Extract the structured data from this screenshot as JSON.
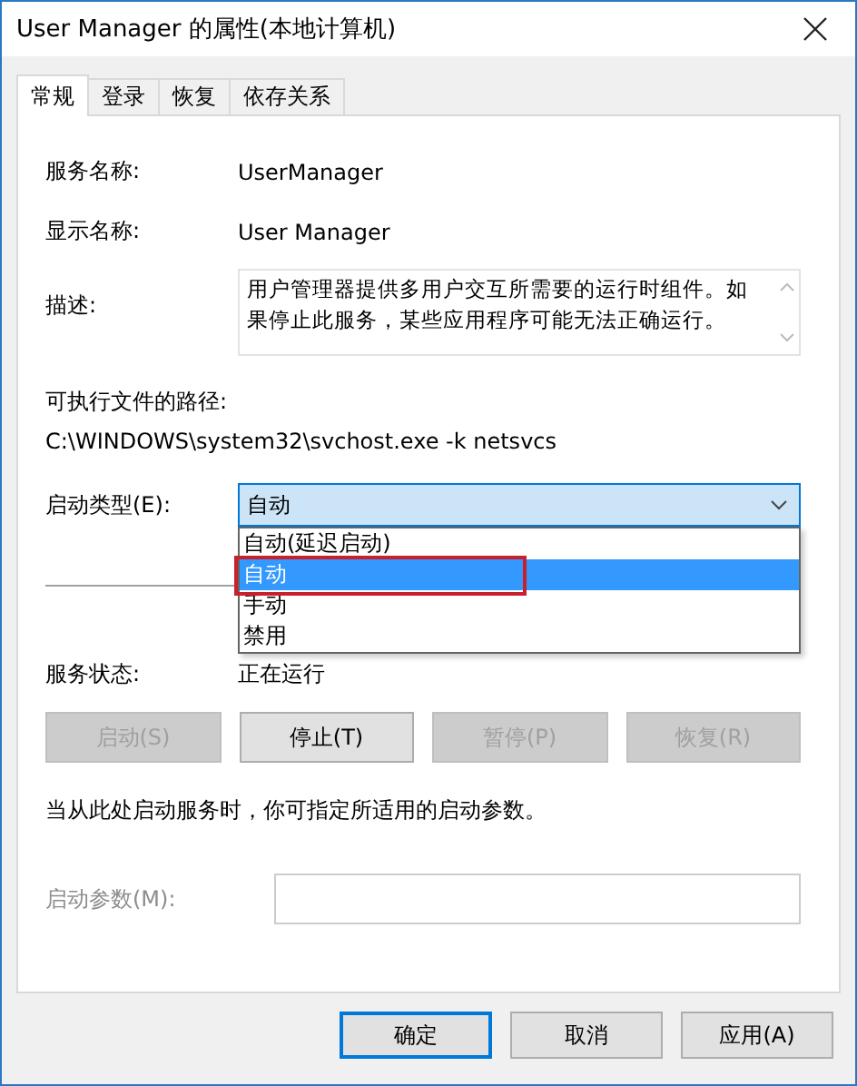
{
  "window": {
    "title": "User Manager 的属性(本地计算机)"
  },
  "tabs": [
    {
      "label": "常规",
      "selected": true
    },
    {
      "label": "登录",
      "selected": false
    },
    {
      "label": "恢复",
      "selected": false
    },
    {
      "label": "依存关系",
      "selected": false
    }
  ],
  "service_name": {
    "label": "服务名称:",
    "value": "UserManager"
  },
  "display_name": {
    "label": "显示名称:",
    "value": "User Manager"
  },
  "description": {
    "label": "描述:",
    "value": "用户管理器提供多用户交互所需要的运行时组件。如果停止此服务，某些应用程序可能无法正确运行。"
  },
  "executable": {
    "label": "可执行文件的路径:",
    "value": "C:\\WINDOWS\\system32\\svchost.exe -k netsvcs"
  },
  "startup_type": {
    "label": "启动类型(E):",
    "value": "自动",
    "expanded": true,
    "options": [
      {
        "label": "自动(延迟启动)",
        "selected": false
      },
      {
        "label": "自动",
        "selected": true
      },
      {
        "label": "手动",
        "selected": false
      },
      {
        "label": "禁用",
        "selected": false
      }
    ]
  },
  "service_status": {
    "label": "服务状态:",
    "value": "正在运行"
  },
  "service_buttons": [
    {
      "label": "启动(S)",
      "disabled": true
    },
    {
      "label": "停止(T)",
      "disabled": false
    },
    {
      "label": "暂停(P)",
      "disabled": true
    },
    {
      "label": "恢复(R)",
      "disabled": true
    }
  ],
  "hint": "当从此处启动服务时，你可指定所适用的启动参数。",
  "start_params": {
    "label": "启动参数(M):",
    "disabled": true
  },
  "dialog_buttons": [
    {
      "label": "确定",
      "default": true
    },
    {
      "label": "取消",
      "default": false
    },
    {
      "label": "应用(A)",
      "default": false
    }
  ]
}
